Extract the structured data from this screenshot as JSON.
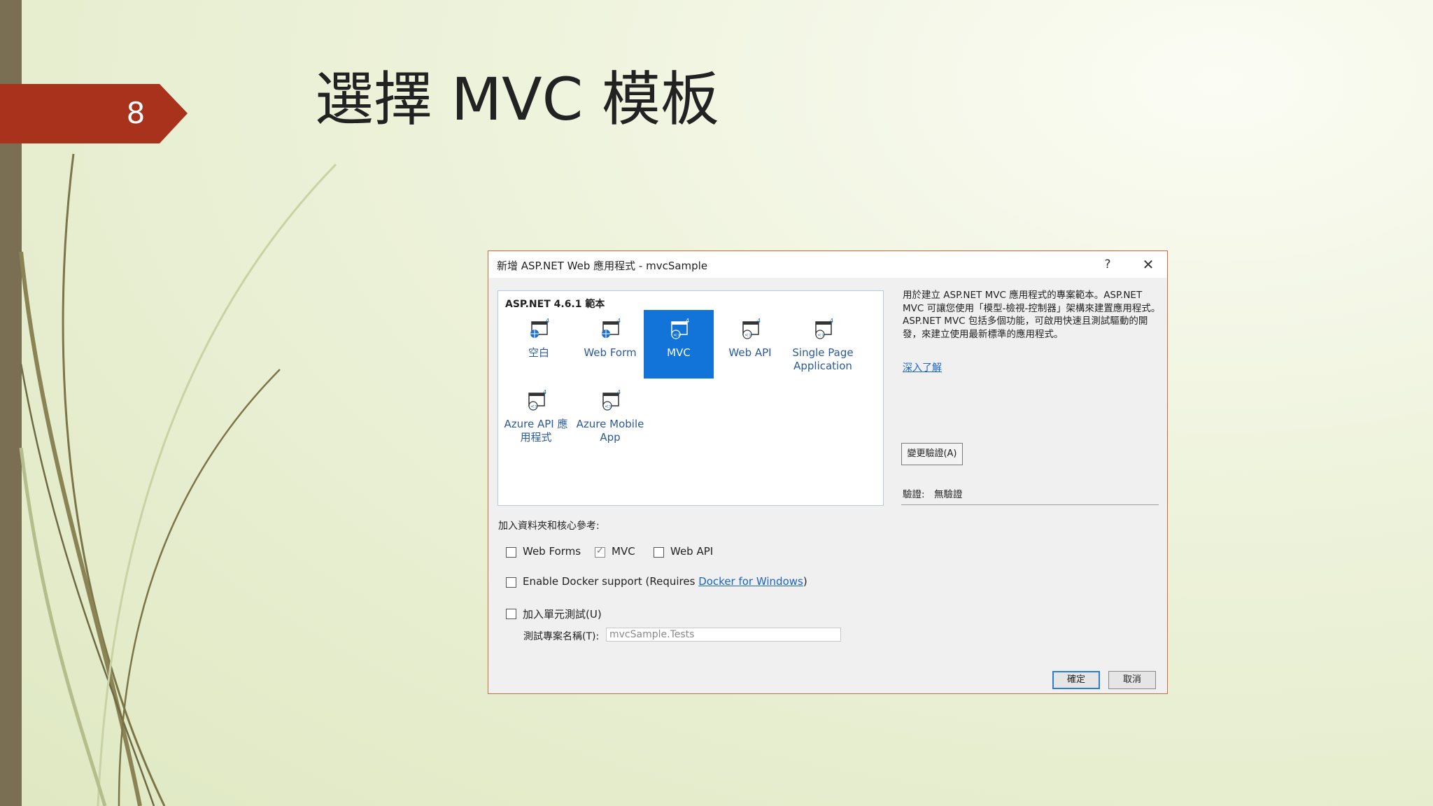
{
  "slide": {
    "number": "8",
    "title": "選擇 MVC 模板"
  },
  "dialog": {
    "title": "新增 ASP.NET Web 應用程式 - mvcSample",
    "help_glyph": "?",
    "close_glyph": "✕",
    "templates_header": "ASP.NET 4.6.1 範本",
    "templates": [
      {
        "label": "空白",
        "selected": false,
        "icon": "globe-window-icon"
      },
      {
        "label": "Web Form",
        "selected": false,
        "icon": "globe-window-icon"
      },
      {
        "label": "MVC",
        "selected": true,
        "icon": "code-window-icon"
      },
      {
        "label": "Web API",
        "selected": false,
        "icon": "code-window-icon"
      },
      {
        "label": "Single Page Application",
        "selected": false,
        "icon": "code-window-icon"
      },
      {
        "label": "Azure API 應用程式",
        "selected": false,
        "icon": "code-window-icon"
      },
      {
        "label": "Azure Mobile App",
        "selected": false,
        "icon": "code-window-icon"
      }
    ],
    "description": "用於建立 ASP.NET MVC 應用程式的專案範本。ASP.NET MVC 可讓您使用「模型-檢視-控制器」架構來建置應用程式。ASP.NET MVC 包括多個功能，可啟用快速且測試驅動的開發，來建立使用最新標準的應用程式。",
    "learn_more": "深入了解",
    "change_auth_button": "變更驗證(A)",
    "auth_label": "驗證:",
    "auth_value": "無驗證",
    "add_folders_label": "加入資料夾和核心參考:",
    "folders": {
      "web_forms": "Web Forms",
      "mvc": "MVC",
      "web_api": "Web API"
    },
    "docker": {
      "prefix": "Enable Docker support (Requires ",
      "link": "Docker for Windows",
      "suffix": ")"
    },
    "unit_test_label": "加入單元測試(U)",
    "test_project_label": "測試專案名稱(T):",
    "test_project_value": "mvcSample.Tests",
    "ok_button": "確定",
    "cancel_button": "取消",
    "colors": {
      "selected_tile": "#1273d8",
      "link": "#1a64c8",
      "slide_badge": "#a8321c",
      "dialog_border": "#d06a3a"
    }
  }
}
